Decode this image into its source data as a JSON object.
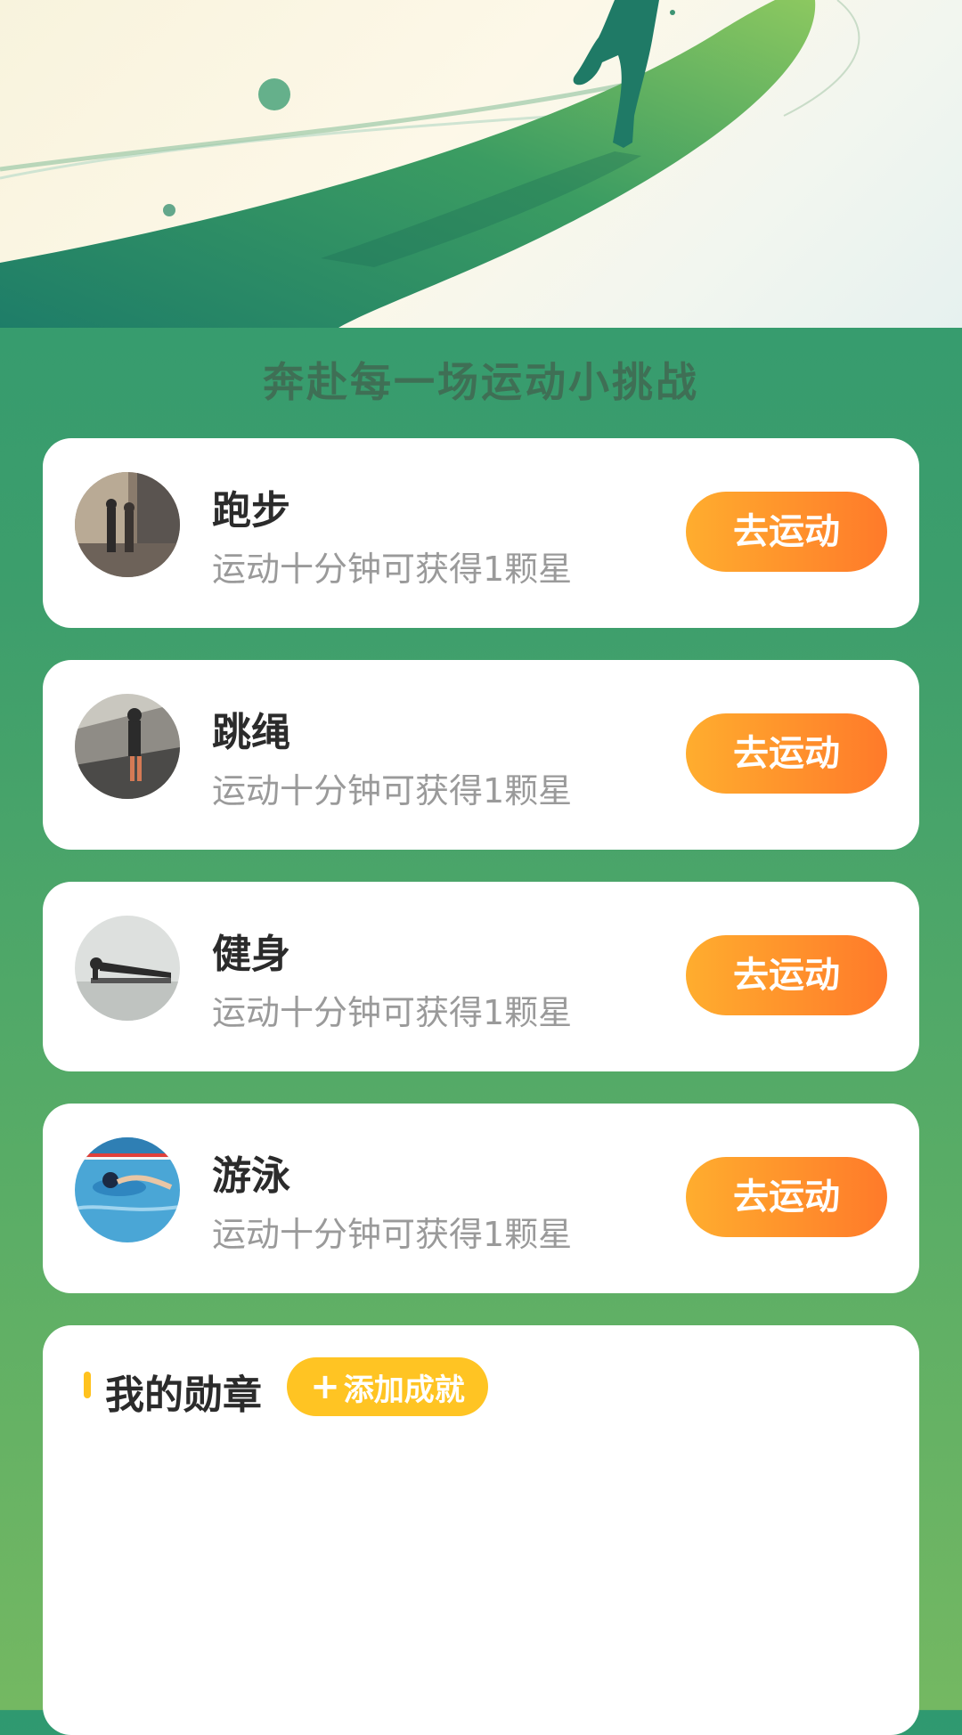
{
  "hero": {
    "illustration": "runner-on-green-track"
  },
  "section_title": "奔赴每一场运动小挑战",
  "activities": [
    {
      "title": "跑步",
      "subtitle": "运动十分钟可获得1颗星",
      "button": "去运动",
      "thumb": "running-photo"
    },
    {
      "title": "跳绳",
      "subtitle": "运动十分钟可获得1颗星",
      "button": "去运动",
      "thumb": "jump-rope-photo"
    },
    {
      "title": "健身",
      "subtitle": "运动十分钟可获得1颗星",
      "button": "去运动",
      "thumb": "plank-photo"
    },
    {
      "title": "游泳",
      "subtitle": "运动十分钟可获得1颗星",
      "button": "去运动",
      "thumb": "swimming-photo"
    }
  ],
  "medals": {
    "title": "我的勋章",
    "add_button": "添加成就",
    "add_icon": "plus-icon"
  },
  "colors": {
    "background_green": "#3d9e6c",
    "button_orange_start": "#ffad2e",
    "button_orange_end": "#ff7a2a",
    "accent_yellow": "#ffc423"
  }
}
